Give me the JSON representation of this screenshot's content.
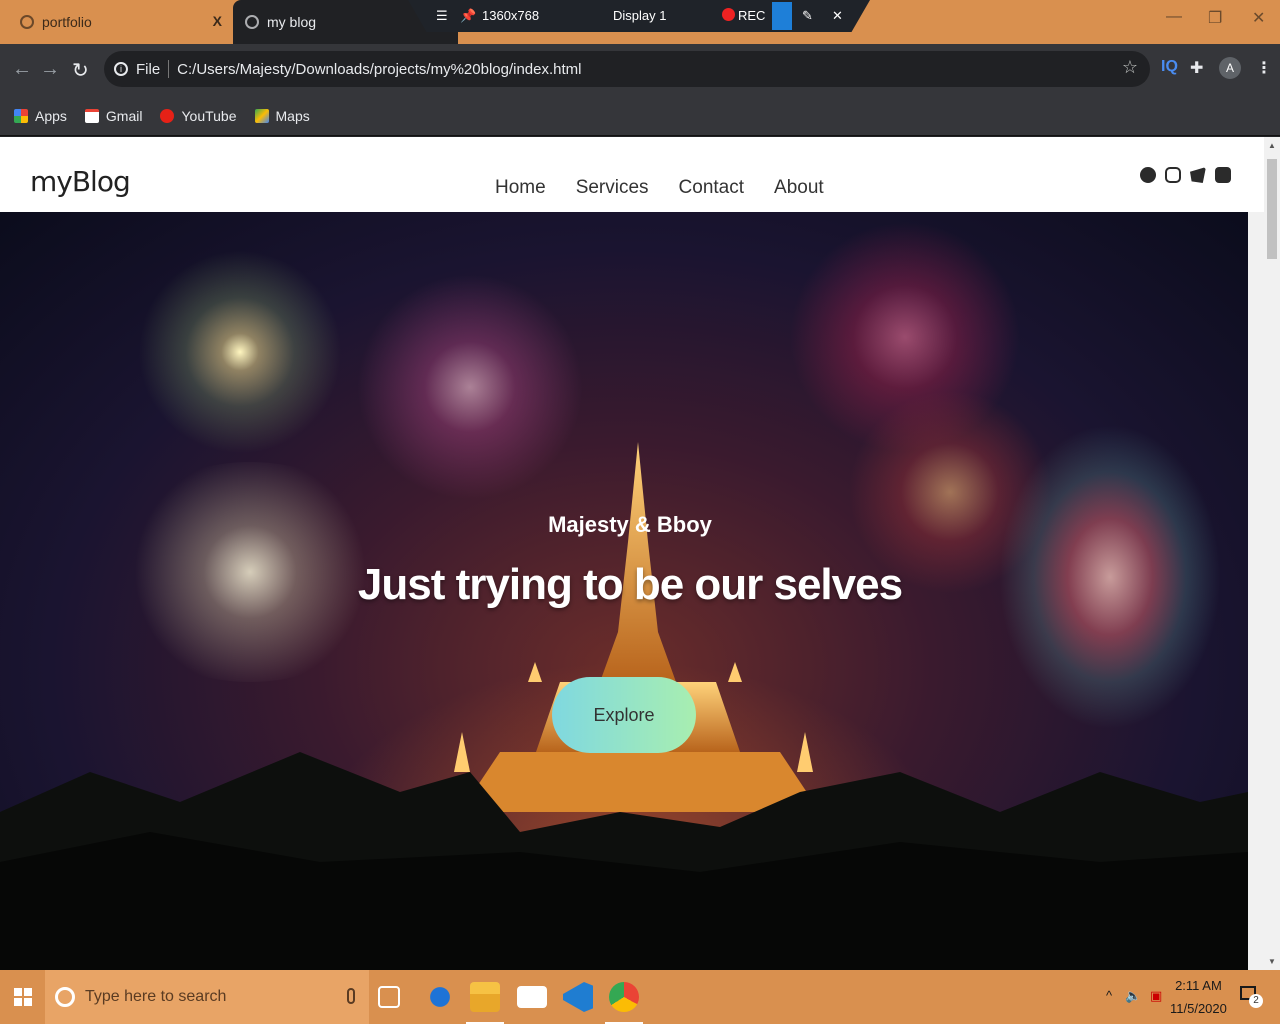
{
  "browser": {
    "tabs": [
      {
        "title": "portfolio",
        "close": "X"
      },
      {
        "title": "my blog"
      }
    ],
    "recorder": {
      "resolution": "1360x768",
      "display": "Display 1",
      "rec": "REC"
    },
    "address": {
      "scheme": "File",
      "url": "C:/Users/Majesty/Downloads/projects/my%20blog/index.html"
    },
    "extension_label": "IQ",
    "profile_initial": "A",
    "bookmarks": [
      {
        "label": "Apps",
        "icon": "apps-grid-icon"
      },
      {
        "label": "Gmail",
        "icon": "gmail-icon"
      },
      {
        "label": "YouTube",
        "icon": "youtube-icon"
      },
      {
        "label": "Maps",
        "icon": "maps-icon"
      }
    ]
  },
  "site": {
    "logo": "myBlog",
    "nav": [
      "Home",
      "Services",
      "Contact",
      "About"
    ],
    "social": [
      "facebook-icon",
      "instagram-icon",
      "twitter-icon",
      "youtube-icon"
    ],
    "hero": {
      "subtitle": "Majesty & Bboy",
      "title": "Just trying to be our selves",
      "button": "Explore"
    }
  },
  "taskbar": {
    "search_placeholder": "Type here to search",
    "time": "2:11 AM",
    "date": "11/5/2020",
    "notification_count": "2",
    "apps": [
      "task-view-icon",
      "edge-icon",
      "file-explorer-icon",
      "mail-icon",
      "vscode-icon",
      "chrome-icon"
    ]
  },
  "colors": {
    "chrome_frame": "#d9904f",
    "button_gradient_start": "#7fd8e0",
    "button_gradient_end": "#a8eeb0"
  }
}
